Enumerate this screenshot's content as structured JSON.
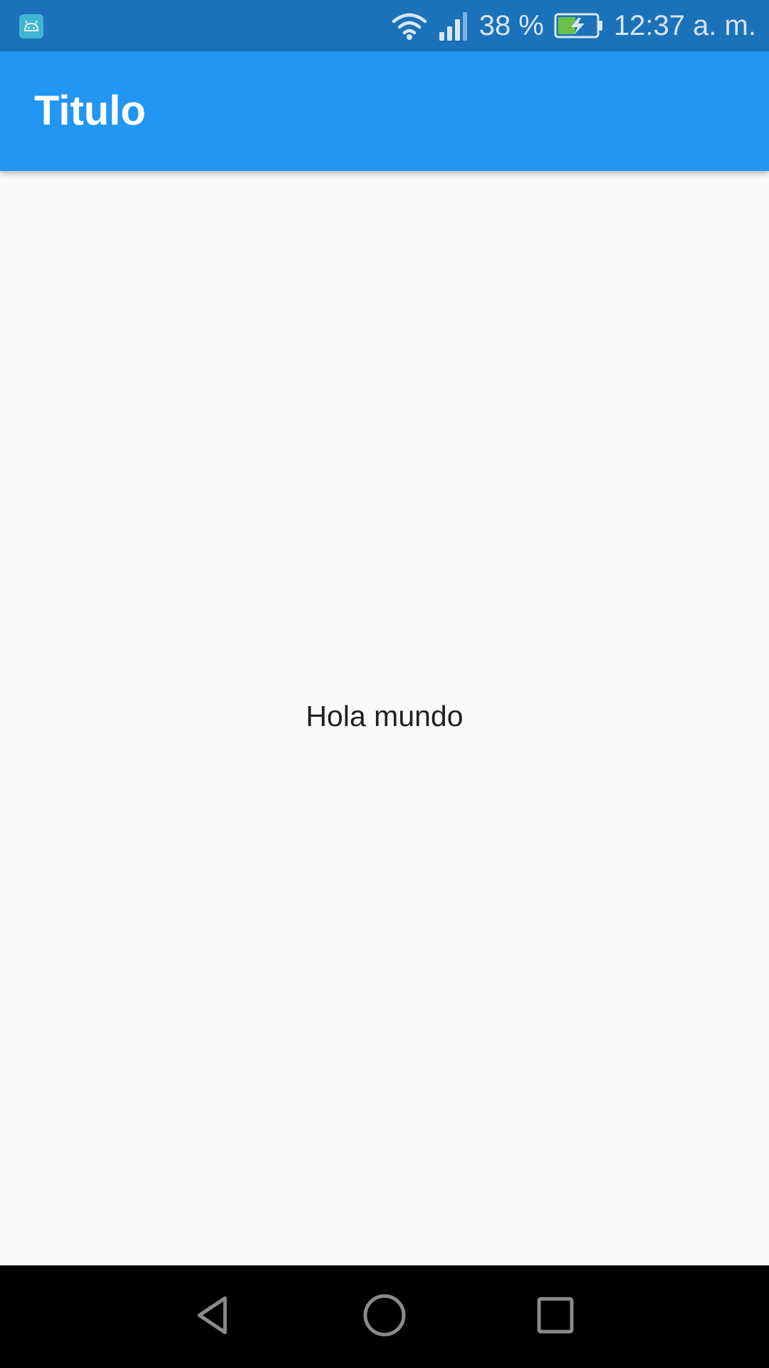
{
  "status_bar": {
    "battery_percent": "38 %",
    "time": "12:37 a. m.",
    "background_color": "#1b72b8",
    "icons": [
      "android-app-icon",
      "wifi-icon",
      "cell-signal-icon",
      "battery-charging-icon"
    ]
  },
  "app_bar": {
    "title": "Titulo",
    "color": "#2196f3"
  },
  "body": {
    "text": "Hola mundo",
    "background_color": "#fafafa"
  },
  "nav_bar": {
    "icons": [
      "back-icon",
      "home-icon",
      "recents-icon"
    ]
  }
}
